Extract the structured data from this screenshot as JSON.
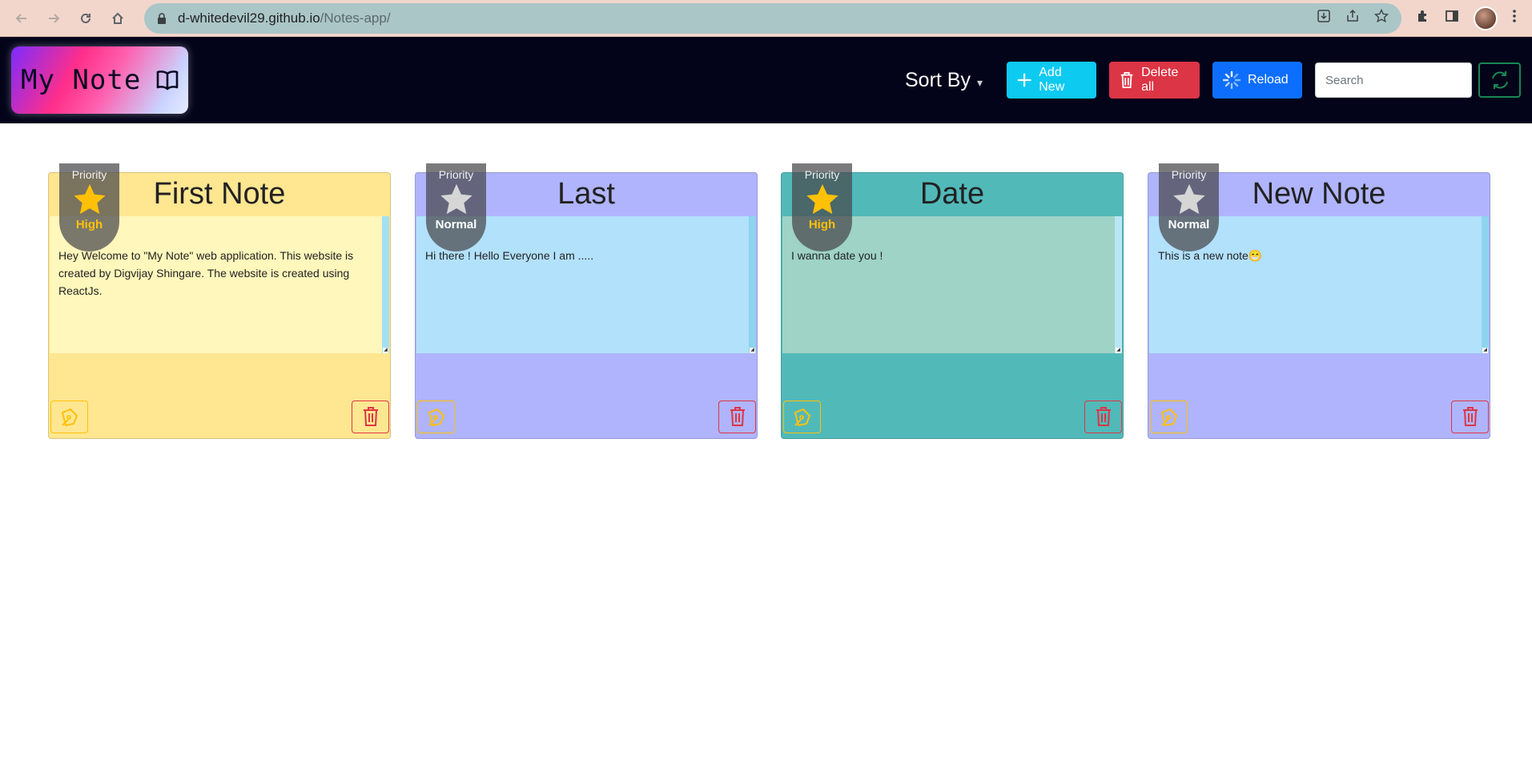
{
  "browser": {
    "url_host": "d-whitedevil29.github.io",
    "url_path": "/Notes-app/"
  },
  "navbar": {
    "brand": "My Note",
    "sort_label": "Sort By",
    "add_label": "Add New",
    "delete_all_label": "Delete all",
    "reload_label": "Reload",
    "search_placeholder": "Search"
  },
  "notes": [
    {
      "title": "First Note",
      "priority_title": "Priority",
      "priority": "High",
      "body": "Hey Welcome to \"My Note\" web application. This website is created by Digvijay Shingare. The website is created using ReactJs."
    },
    {
      "title": "Last",
      "priority_title": "Priority",
      "priority": "Normal",
      "body": "Hi there ! Hello Everyone I am ....."
    },
    {
      "title": "Date",
      "priority_title": "Priority",
      "priority": "High",
      "body": "I wanna date you !"
    },
    {
      "title": "New Note",
      "priority_title": "Priority",
      "priority": "Normal",
      "body": "This is a new note😁"
    }
  ],
  "colors": {
    "navbar_bg": "#03031a",
    "high_star": "#ffc107",
    "normal_star": "#d6d6d6"
  },
  "icons": [
    "back-icon",
    "forward-icon",
    "reload-page-icon",
    "home-icon",
    "lock-icon",
    "install-icon",
    "share-icon",
    "bookmark-star-icon",
    "extensions-icon",
    "side-panel-icon",
    "menu-dots-icon",
    "book-icon",
    "plus-icon",
    "trash-icon",
    "spinner-icon",
    "refresh-icon",
    "star-icon",
    "pen-icon"
  ]
}
